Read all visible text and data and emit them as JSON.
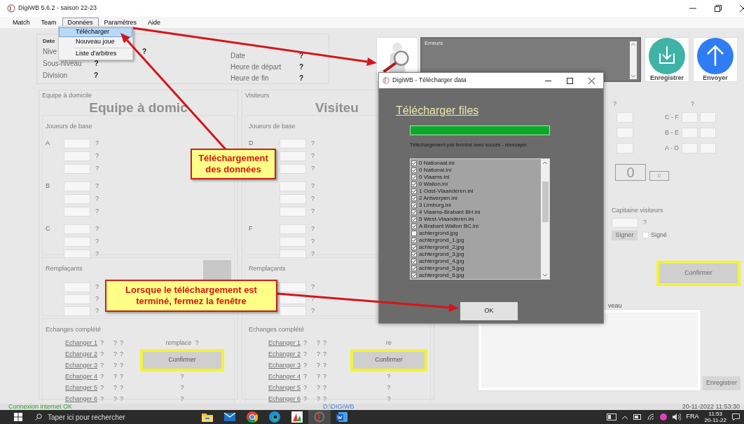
{
  "window": {
    "title": "DigiWB 5.6.2 - saison 22-23"
  },
  "menu": [
    {
      "label": "Match",
      "selected": false
    },
    {
      "label": "Team",
      "selected": false
    },
    {
      "label": "Données",
      "selected": true
    },
    {
      "label": "Paramètres",
      "selected": false
    },
    {
      "label": "Aide",
      "selected": false
    }
  ],
  "dropdown": [
    {
      "kind": "item",
      "label": "Télécharger",
      "selected": true
    },
    {
      "kind": "item",
      "label": "Nouveau joue",
      "selected": false
    },
    {
      "kind": "separator"
    },
    {
      "kind": "item",
      "label": "Liste d'arbitres",
      "selected": false
    }
  ],
  "match_info": {
    "left": [
      {
        "label": "Date"
      },
      {
        "label": "Nive",
        "value": "?"
      },
      {
        "label": "Sous-niveau",
        "value": "?"
      },
      {
        "label": "Division",
        "value": "?"
      }
    ],
    "right": [
      {
        "label": "Date",
        "value": "?"
      },
      {
        "label": "Heure de départ",
        "value": "?"
      },
      {
        "label": "Heure de fin",
        "value": "?"
      }
    ]
  },
  "errors": {
    "legend": "Erreurs"
  },
  "actions": [
    {
      "kind": "save",
      "label": "Enregistrer"
    },
    {
      "kind": "send",
      "label": "Envoyer"
    }
  ],
  "home": {
    "legend": "Equipe à domicile",
    "heading": "Equipe à domic",
    "players_legend": "Joueurs de base",
    "groups": [
      {
        "letter": "A",
        "values": [
          "?",
          "?",
          "?"
        ]
      },
      {
        "letter": "B",
        "values": [
          "?",
          "?",
          "?"
        ]
      },
      {
        "letter": "C",
        "values": [
          "?",
          "?",
          "?"
        ]
      }
    ],
    "subs_legend": "Remplaçants",
    "subs": [
      "?",
      "?",
      "?"
    ],
    "exchanges_legend": "Echanges complété",
    "exchanges": [
      {
        "link": "Echanger 1",
        "values": [
          "?",
          "?",
          "?"
        ]
      },
      {
        "link": "Echanger 2",
        "values": [
          "?",
          "?",
          "?"
        ]
      },
      {
        "link": "Echanger 3",
        "values": [
          "?",
          "?",
          "?"
        ]
      },
      {
        "link": "Echanger 4",
        "values": [
          "?",
          "?",
          "?"
        ]
      },
      {
        "link": "Echanger 5",
        "values": [
          "?",
          "?",
          "?"
        ]
      },
      {
        "link": "Echanger 6",
        "values": [
          "?",
          "?",
          "?"
        ]
      }
    ],
    "replace": {
      "label": "remplace",
      "value": "?"
    },
    "confirm": "Confirmer",
    "notes": [
      "?",
      "?",
      "?"
    ]
  },
  "visitors": {
    "legend": "Visiteurs",
    "heading": "Visiteu",
    "players_legend": "Joueurs de base",
    "groups": [
      {
        "letter": "D",
        "values": [
          "?",
          "?",
          "?"
        ]
      },
      {
        "values": [
          "?",
          "?",
          "?"
        ]
      },
      {
        "letter": "F",
        "values": [
          "?",
          "?",
          "?"
        ]
      }
    ],
    "subs_legend": "Remplaçants",
    "subs": [
      "?",
      "?",
      "?"
    ],
    "exchanges_legend": "Echanges complété",
    "exchanges": [
      {
        "link": "Echanger 1",
        "values": [
          "?",
          "?",
          "?"
        ]
      },
      {
        "link": "Echanger 2",
        "values": [
          "?",
          "?",
          "?"
        ]
      },
      {
        "link": "Echanger 3",
        "values": [
          "?",
          "?",
          "?"
        ]
      },
      {
        "link": "Echanger 4",
        "values": [
          "?",
          "?",
          "?"
        ]
      },
      {
        "link": "Echanger 5",
        "values": [
          "?",
          "?",
          "?"
        ]
      },
      {
        "link": "Echanger 6",
        "values": [
          "?",
          "?",
          "?"
        ]
      }
    ],
    "replace": {
      "label": "re"
    },
    "confirm": "Confirmer",
    "notes": [
      "?",
      "?",
      "?"
    ]
  },
  "score": {
    "headers": [
      "?",
      "?"
    ],
    "rows": [
      {
        "label": "C - F"
      },
      {
        "label": "B - E"
      },
      {
        "label": "A - D"
      }
    ],
    "total": "0",
    "small_total": "0"
  },
  "captain": {
    "label": "Capitaine visiteurs",
    "value": "?",
    "sign_button": "Signer",
    "signed": {
      "label": "Signé",
      "checked": false
    }
  },
  "confirm": "Confirmer",
  "comments": {
    "label": "veau"
  },
  "save_button": "Enregistrer",
  "status": {
    "connection": "Connexion internet OK",
    "path": "D:\\DIGIWB",
    "datetime": "20-11-2022 11:53:30"
  },
  "dialog": {
    "title": "DigiWB - Télécharger data",
    "heading": "Télécharger files",
    "progress": {
      "level": 1
    },
    "message": "Téléchargement pas terminé avec succès - réessayer.",
    "files": [
      {
        "name": "0 Nationaal.ini",
        "checked": true
      },
      {
        "name": "0 National.ini",
        "checked": true
      },
      {
        "name": "0 Vlaams.ini",
        "checked": true
      },
      {
        "name": "0 Wallon.ini",
        "checked": true
      },
      {
        "name": "1 Oost-Vlaanderen.ini",
        "checked": true
      },
      {
        "name": "2 Antwerpen.ini",
        "checked": true
      },
      {
        "name": "3 Limburg.ini",
        "checked": true
      },
      {
        "name": "4 Vlaams-Brabant BH.ini",
        "checked": true
      },
      {
        "name": "5 West-Vlaanderen.ini",
        "checked": true
      },
      {
        "name": "A Brabant Wallon BC.ini",
        "checked": true
      },
      {
        "name": "achtergrond.jpg",
        "checked": false
      },
      {
        "name": "achtergrond_1.jpg",
        "checked": true
      },
      {
        "name": "achtergrond_2.jpg",
        "checked": true
      },
      {
        "name": "achtergrond_3.jpg",
        "checked": true
      },
      {
        "name": "achtergrond_4.jpg",
        "checked": true
      },
      {
        "name": "achtergrond_5.jpg",
        "checked": true
      },
      {
        "name": "achtergrond_6.jpg",
        "checked": true
      }
    ],
    "ok": "OK"
  },
  "callouts": [
    {
      "text": "Téléchargement des données"
    },
    {
      "text": "Lorsque le téléchargement est terminé, fermez la fenêtre"
    }
  ],
  "taskbar": {
    "search_placeholder": "Taper ici pour rechercher",
    "apps": [
      {
        "kind": "folder",
        "selected": false
      },
      {
        "kind": "mail",
        "selected": false
      },
      {
        "kind": "browser",
        "selected": false
      },
      {
        "kind": "edge",
        "selected": false
      },
      {
        "kind": "chart",
        "selected": false
      },
      {
        "kind": "digiwb",
        "selected": true
      },
      {
        "kind": "word",
        "selected": false
      }
    ],
    "language": "FRA",
    "time": "11:53",
    "date": "20-11-22"
  }
}
